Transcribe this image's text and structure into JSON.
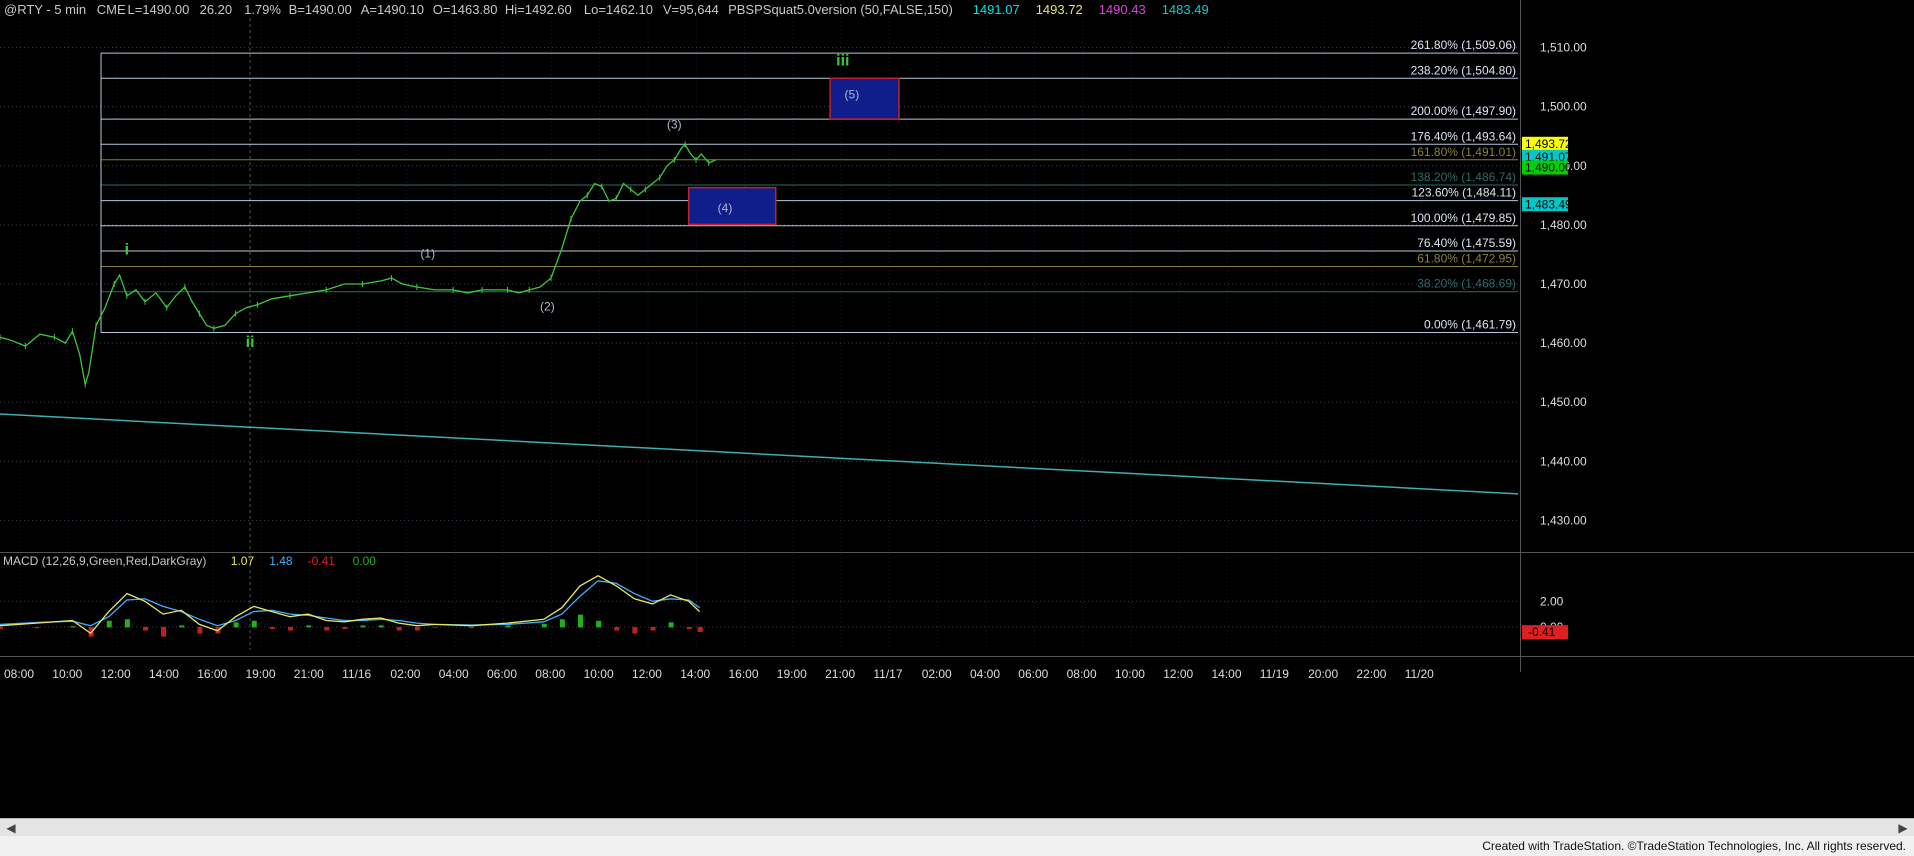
{
  "header": {
    "symbol": "@RTY - 5 min",
    "exchange": "CME",
    "last": "L=1490.00",
    "change": "26.20",
    "change_pct": "1.79%",
    "bid": "B=1490.00",
    "ask": "A=1490.10",
    "open": "O=1463.80",
    "high": "Hi=1492.60",
    "low": "Lo=1462.10",
    "volume": "V=95,644",
    "study": "PBSPSquat5.0version (50,FALSE,150)",
    "study_values": [
      "1491.07",
      "1493.72",
      "1490.43",
      "1483.49"
    ]
  },
  "chart_data": [
    {
      "type": "line",
      "panel": "price",
      "y_ticks": [
        "1,510.00",
        "1,500.00",
        "1,490.00",
        "1,480.00",
        "1,470.00",
        "1,460.00",
        "1,450.00",
        "1,440.00",
        "1,430.00"
      ],
      "ylim": [
        1425,
        1515
      ],
      "x_tick_labels": [
        "08:00",
        "10:00",
        "12:00",
        "14:00",
        "16:00",
        "19:00",
        "21:00",
        "11/16",
        "02:00",
        "04:00",
        "06:00",
        "08:00",
        "10:00",
        "12:00",
        "14:00",
        "16:00",
        "19:00",
        "21:00",
        "11/17",
        "02:00",
        "04:00",
        "06:00",
        "08:00",
        "10:00",
        "12:00",
        "14:00",
        "11/19",
        "20:00",
        "22:00",
        "11/20"
      ],
      "price_path": [
        [
          0,
          1461
        ],
        [
          6,
          1460.5
        ],
        [
          14,
          1459.5
        ],
        [
          22,
          1461.5
        ],
        [
          30,
          1461
        ],
        [
          36,
          1460
        ],
        [
          40,
          1462
        ],
        [
          44,
          1458
        ],
        [
          47,
          1453
        ],
        [
          49,
          1455
        ],
        [
          53,
          1463
        ],
        [
          58,
          1466
        ],
        [
          63,
          1470
        ],
        [
          66,
          1471.5
        ],
        [
          70,
          1468
        ],
        [
          75,
          1469
        ],
        [
          80,
          1467
        ],
        [
          86,
          1468.5
        ],
        [
          92,
          1466
        ],
        [
          97,
          1468
        ],
        [
          102,
          1469.5
        ],
        [
          106,
          1467
        ],
        [
          110,
          1465
        ],
        [
          114,
          1463
        ],
        [
          118,
          1462.5
        ],
        [
          124,
          1463
        ],
        [
          130,
          1465
        ],
        [
          136,
          1466
        ],
        [
          142,
          1466.5
        ],
        [
          150,
          1467.5
        ],
        [
          160,
          1468
        ],
        [
          170,
          1468.5
        ],
        [
          180,
          1469
        ],
        [
          190,
          1470
        ],
        [
          200,
          1470
        ],
        [
          210,
          1470.5
        ],
        [
          216,
          1471
        ],
        [
          222,
          1470
        ],
        [
          230,
          1469.5
        ],
        [
          240,
          1469
        ],
        [
          250,
          1469
        ],
        [
          258,
          1468.5
        ],
        [
          266,
          1469
        ],
        [
          274,
          1469
        ],
        [
          280,
          1469
        ],
        [
          286,
          1468.5
        ],
        [
          292,
          1469
        ],
        [
          298,
          1469.5
        ],
        [
          304,
          1471
        ],
        [
          310,
          1476
        ],
        [
          315,
          1481
        ],
        [
          320,
          1484
        ],
        [
          324,
          1485
        ],
        [
          328,
          1487
        ],
        [
          332,
          1486.5
        ],
        [
          336,
          1484
        ],
        [
          340,
          1484.5
        ],
        [
          344,
          1487
        ],
        [
          348,
          1486
        ],
        [
          352,
          1485
        ],
        [
          356,
          1486
        ],
        [
          360,
          1487
        ],
        [
          364,
          1488
        ],
        [
          368,
          1490
        ],
        [
          372,
          1491
        ],
        [
          376,
          1493
        ],
        [
          378,
          1493.6
        ],
        [
          381,
          1492
        ],
        [
          384,
          1491
        ],
        [
          387,
          1492
        ],
        [
          391,
          1490.5
        ],
        [
          395,
          1491
        ]
      ],
      "price_x_range": [
        0,
        395
      ],
      "fib_levels": [
        {
          "label": "261.80% (1,509.06)",
          "value": 1509.06,
          "color": "#b8c8dc"
        },
        {
          "label": "238.20% (1,504.80)",
          "value": 1504.8,
          "color": "#b8c8dc"
        },
        {
          "label": "200.00% (1,497.90)",
          "value": 1497.9,
          "color": "#b8c8dc"
        },
        {
          "label": "176.40% (1,493.64)",
          "value": 1493.64,
          "color": "#b8c8dc"
        },
        {
          "label": "161.80% (1,491.01)",
          "value": 1491.01,
          "color": "#8a7f3c"
        },
        {
          "label": "138.20% (1,486.74)",
          "value": 1486.74,
          "color": "#2f6b66"
        },
        {
          "label": "123.60% (1,484.11)",
          "value": 1484.11,
          "color": "#b8c8dc"
        },
        {
          "label": "100.00% (1,479.85)",
          "value": 1479.85,
          "color": "#b8c8dc"
        },
        {
          "label": "76.40% (1,475.59)",
          "value": 1475.59,
          "color": "#b8c8dc"
        },
        {
          "label": "61.80% (1,472.95)",
          "value": 1472.95,
          "color": "#8a7f3c"
        },
        {
          "label": "38.20% (1,468.69)",
          "value": 1468.69,
          "color": "#2f6b66"
        },
        {
          "label": "0.00% (1,461.79)",
          "value": 1461.79,
          "color": "#b8c8dc"
        }
      ],
      "right_tags": [
        {
          "text": "1,493.72",
          "value": 1493.72,
          "bg": "#ffff00",
          "fg": "#000"
        },
        {
          "text": "1,491.07",
          "value": 1491.5,
          "bg": "#00c8c8",
          "fg": "#000"
        },
        {
          "text": "1,490.00",
          "value": 1489.7,
          "bg": "#00d000",
          "fg": "#000"
        },
        {
          "text": "1,483.49",
          "value": 1483.49,
          "bg": "#00c8c8",
          "fg": "#000"
        }
      ],
      "wave_labels": [
        {
          "text": "i",
          "x": 70,
          "y": 1475,
          "color": "#3cc83c",
          "bold": true
        },
        {
          "text": "ii",
          "x": 138,
          "y": 1459.3,
          "color": "#3cc83c",
          "bold": true
        },
        {
          "text": "iii",
          "x": 465,
          "y": 1507,
          "color": "#3cc83c",
          "bold": true
        },
        {
          "text": "(1)",
          "x": 236,
          "y": 1474.5,
          "color": "#b0b8d0",
          "bold": false
        },
        {
          "text": "(2)",
          "x": 302,
          "y": 1465.5,
          "color": "#b0b8d0",
          "bold": false
        },
        {
          "text": "(3)",
          "x": 372,
          "y": 1496.3,
          "color": "#b0b8d0",
          "bold": false
        },
        {
          "text": "(4)",
          "x": 400,
          "y": 1482.2,
          "color": "#b0b8d0",
          "bold": false
        },
        {
          "text": "(5)",
          "x": 470,
          "y": 1501.4,
          "color": "#b0b8d0",
          "bold": false
        }
      ],
      "target_boxes": [
        {
          "label": "(4)",
          "x0": 380,
          "x1": 428,
          "y0": 1480.1,
          "y1": 1486.3
        },
        {
          "label": "(5)",
          "x0": 458,
          "x1": 496,
          "y0": 1497.9,
          "y1": 1504.8
        }
      ],
      "trendline": {
        "y_start": 1448.0,
        "y_end": 1434.5,
        "color": "#3ab0b0"
      }
    },
    {
      "type": "line",
      "panel": "macd",
      "title": "MACD (12,26,9,Green,Red,DarkGray)",
      "values_text": [
        "1.07",
        "1.48",
        "-0.41",
        "0.00"
      ],
      "y_ticks": [
        "2.00",
        "0.00"
      ],
      "right_tag": {
        "text": "-0.41",
        "bg": "#e02020",
        "fg": "#000"
      },
      "ylim": [
        -1.8,
        4.6
      ],
      "macd_line": [
        [
          0,
          0.1
        ],
        [
          20,
          0.3
        ],
        [
          40,
          0.5
        ],
        [
          50,
          -0.5
        ],
        [
          60,
          1.2
        ],
        [
          70,
          2.6
        ],
        [
          80,
          2.0
        ],
        [
          90,
          1.0
        ],
        [
          100,
          1.3
        ],
        [
          110,
          0.2
        ],
        [
          120,
          -0.3
        ],
        [
          130,
          0.8
        ],
        [
          140,
          1.6
        ],
        [
          150,
          1.2
        ],
        [
          160,
          0.8
        ],
        [
          170,
          1.0
        ],
        [
          180,
          0.5
        ],
        [
          190,
          0.4
        ],
        [
          200,
          0.6
        ],
        [
          210,
          0.7
        ],
        [
          220,
          0.3
        ],
        [
          230,
          0.1
        ],
        [
          240,
          0.2
        ],
        [
          260,
          0.1
        ],
        [
          280,
          0.3
        ],
        [
          300,
          0.6
        ],
        [
          310,
          1.5
        ],
        [
          320,
          3.2
        ],
        [
          330,
          4.0
        ],
        [
          340,
          3.2
        ],
        [
          350,
          2.2
        ],
        [
          360,
          1.8
        ],
        [
          370,
          2.5
        ],
        [
          380,
          2.0
        ],
        [
          386,
          1.2
        ]
      ],
      "signal_line": [
        [
          0,
          0.2
        ],
        [
          20,
          0.35
        ],
        [
          40,
          0.45
        ],
        [
          50,
          0.1
        ],
        [
          60,
          0.8
        ],
        [
          70,
          2.1
        ],
        [
          80,
          2.2
        ],
        [
          90,
          1.6
        ],
        [
          100,
          1.2
        ],
        [
          110,
          0.6
        ],
        [
          120,
          0.1
        ],
        [
          130,
          0.5
        ],
        [
          140,
          1.2
        ],
        [
          150,
          1.3
        ],
        [
          160,
          1.0
        ],
        [
          170,
          0.9
        ],
        [
          180,
          0.7
        ],
        [
          190,
          0.5
        ],
        [
          200,
          0.5
        ],
        [
          210,
          0.6
        ],
        [
          220,
          0.5
        ],
        [
          230,
          0.3
        ],
        [
          240,
          0.2
        ],
        [
          260,
          0.15
        ],
        [
          280,
          0.2
        ],
        [
          300,
          0.4
        ],
        [
          310,
          1.0
        ],
        [
          320,
          2.4
        ],
        [
          330,
          3.6
        ],
        [
          340,
          3.4
        ],
        [
          350,
          2.6
        ],
        [
          360,
          2.0
        ],
        [
          370,
          2.2
        ],
        [
          380,
          2.1
        ],
        [
          386,
          1.5
        ]
      ],
      "macd_x_range": [
        0,
        395
      ]
    }
  ],
  "footer": {
    "credit": "Created with TradeStation. ©TradeStation Technologies, Inc. All rights reserved."
  },
  "colors": {
    "background": "#000000",
    "grid": "#3a3a4a",
    "price": "#3cc83c",
    "macd": "#e8e860",
    "signal": "#40b0ff",
    "hist_pos": "#20b020",
    "hist_neg": "#c02020",
    "box_fill": "#101e8c",
    "box_stroke": "#c02030"
  }
}
